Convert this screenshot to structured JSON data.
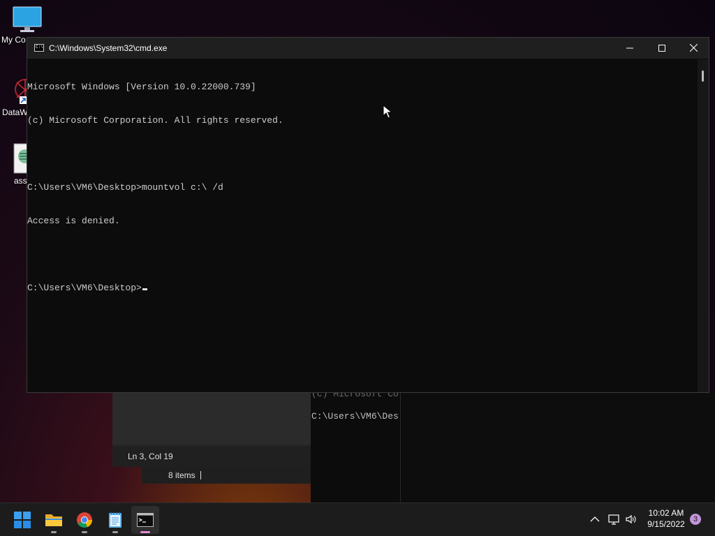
{
  "desktop": {
    "icons": [
      {
        "label": "My Co",
        "icon": "monitor-icon"
      },
      {
        "label": "DataW",
        "icon": "datawarrior-shortcut-icon"
      },
      {
        "label": "ass",
        "icon": "text-file-icon"
      }
    ]
  },
  "background_windows": {
    "notepad_status": "Ln 3, Col 19",
    "explorer_status": "8 items",
    "cmd_lines": [
      "(c) Microsoft Co",
      "C:\\Users\\VM6\\Des"
    ]
  },
  "cmd_window": {
    "title": "C:\\Windows\\System32\\cmd.exe",
    "lines": [
      "Microsoft Windows [Version 10.0.22000.739]",
      "(c) Microsoft Corporation. All rights reserved.",
      "",
      "C:\\Users\\VM6\\Desktop>mountvol c:\\ /d",
      "Access is denied.",
      ""
    ],
    "prompt": "C:\\Users\\VM6\\Desktop>",
    "controls": {
      "minimize": "minimize-icon",
      "maximize": "maximize-icon",
      "close": "close-icon"
    }
  },
  "taskbar": {
    "apps": [
      {
        "name": "start",
        "icon": "windows-start-icon"
      },
      {
        "name": "file-explorer",
        "icon": "folder-icon"
      },
      {
        "name": "chrome",
        "icon": "chrome-icon"
      },
      {
        "name": "notepad",
        "icon": "notepad-icon"
      },
      {
        "name": "command-prompt",
        "icon": "cmd-icon",
        "active": true
      }
    ],
    "tray": {
      "time": "10:02 AM",
      "date": "9/15/2022",
      "notification_count": "3"
    }
  },
  "colors": {
    "console_text": "#cccccc",
    "console_bg": "#0c0c0c",
    "titlebar_bg": "#1f1f1f",
    "taskbar_bg": "#1c1c1c",
    "active_indicator": "#e08ccf"
  }
}
